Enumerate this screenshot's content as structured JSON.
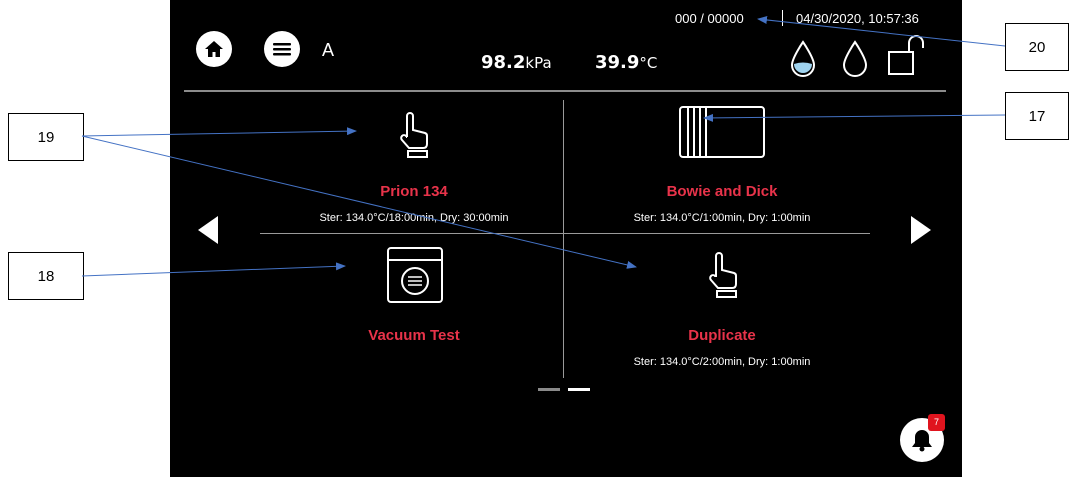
{
  "header": {
    "mode": "A",
    "counter": "000 / 00000",
    "datetime": "04/30/2020, 10:57:36",
    "pressure_value": "98.2",
    "pressure_unit": "kPa",
    "temperature_value": "39.9",
    "temperature_unit": "°C"
  },
  "icons": {
    "home": "home-icon",
    "menu": "menu-icon",
    "water_full": "water-drop-filled-icon",
    "water_empty": "water-drop-empty-icon",
    "lock": "unlock-icon",
    "bell": "bell-icon"
  },
  "programs": [
    {
      "title": "Prion 134",
      "subtitle": "Ster: 134.0°C/18:00min, Dry: 30:00min",
      "icon": "hand-pointer-icon"
    },
    {
      "title": "Bowie and Dick",
      "subtitle": "Ster: 134.0°C/1:00min, Dry: 1:00min",
      "icon": "test-pack-icon"
    },
    {
      "title": "Vacuum Test",
      "subtitle": "",
      "icon": "chamber-icon"
    },
    {
      "title": "Duplicate",
      "subtitle": "Ster: 134.0°C/2:00min, Dry: 1:00min",
      "icon": "hand-pointer-icon"
    }
  ],
  "notifications": {
    "count": "7"
  },
  "callouts": [
    "19",
    "18",
    "20",
    "17"
  ],
  "colors": {
    "screen_bg": "#000000",
    "program_title": "#e8334a",
    "annotation_line": "#4472c4",
    "badge": "#e0141e"
  }
}
